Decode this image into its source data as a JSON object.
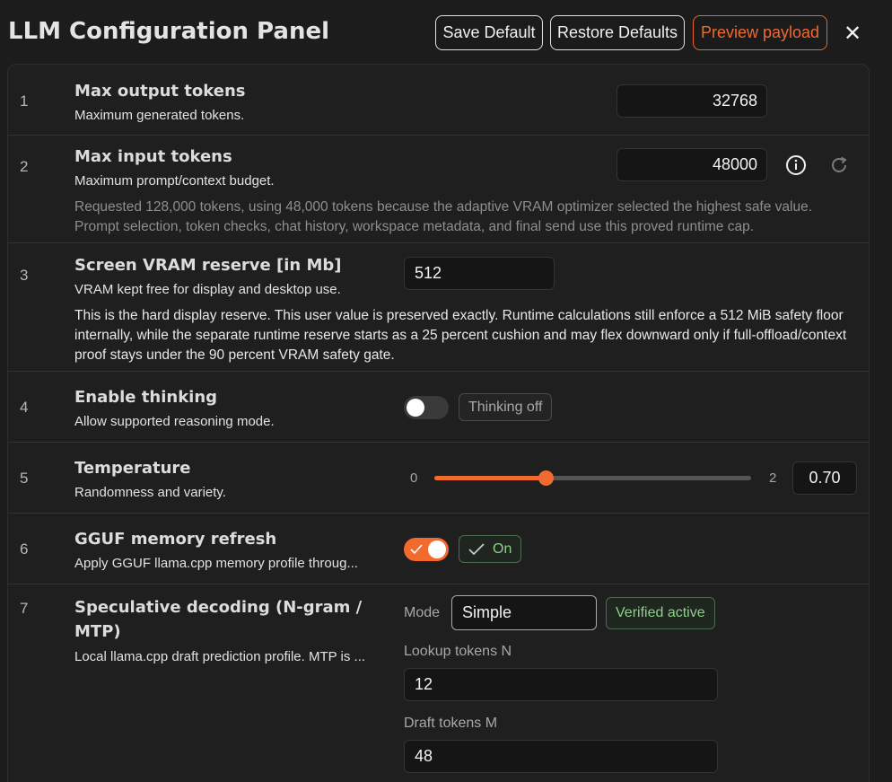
{
  "header": {
    "title": "LLM Configuration Panel",
    "save_label": "Save Default",
    "restore_label": "Restore Defaults",
    "preview_label": "Preview payload",
    "close_glyph": "✕"
  },
  "rows": [
    {
      "num": "1",
      "title": "Max output tokens",
      "desc": "Maximum generated tokens.",
      "value": "32768"
    },
    {
      "num": "2",
      "title": "Max input tokens",
      "desc": "Maximum prompt/context budget.",
      "value": "48000",
      "note": "Requested 128,000 tokens, using 48,000 tokens because the adaptive VRAM optimizer selected the highest safe value. Prompt selection, token checks, chat history, workspace metadata, and final send use this proved runtime cap."
    },
    {
      "num": "3",
      "title": "Screen VRAM reserve [in Mb]",
      "desc": "VRAM kept free for display and desktop use.",
      "value": "512",
      "note": "This is the hard display reserve. This user value is preserved exactly. Runtime calculations still enforce a 512 MiB safety floor internally, while the separate runtime reserve starts as a 25 percent cushion and may flex downward only if full-offload/context proof stays under the 90 percent VRAM safety gate."
    },
    {
      "num": "4",
      "title": "Enable thinking",
      "desc": "Allow supported reasoning mode.",
      "toggle_on": false,
      "chip": "Thinking off"
    },
    {
      "num": "5",
      "title": "Temperature",
      "desc": "Randomness and variety.",
      "min": "0",
      "max": "2",
      "value": 0.7,
      "value_text": "0.70"
    },
    {
      "num": "6",
      "title": "GGUF memory refresh",
      "desc": "Apply GGUF llama.cpp memory profile throug...",
      "toggle_on": true,
      "chip": "On",
      "chip_icon": "check-icon"
    },
    {
      "num": "7",
      "title_line1": "Speculative decoding (N-gram /",
      "title_line2": "MTP)",
      "desc": "Local llama.cpp draft prediction profile. MTP is ...",
      "mode_label": "Mode",
      "mode_value": "Simple",
      "status_chip": "Verified active",
      "lookup_label": "Lookup tokens N",
      "lookup_value": "12",
      "draft_label": "Draft tokens M",
      "draft_value": "48"
    }
  ],
  "colors": {
    "accent": "#f26b2e",
    "success": "#8fcf8a",
    "background": "#1c1c1c"
  }
}
